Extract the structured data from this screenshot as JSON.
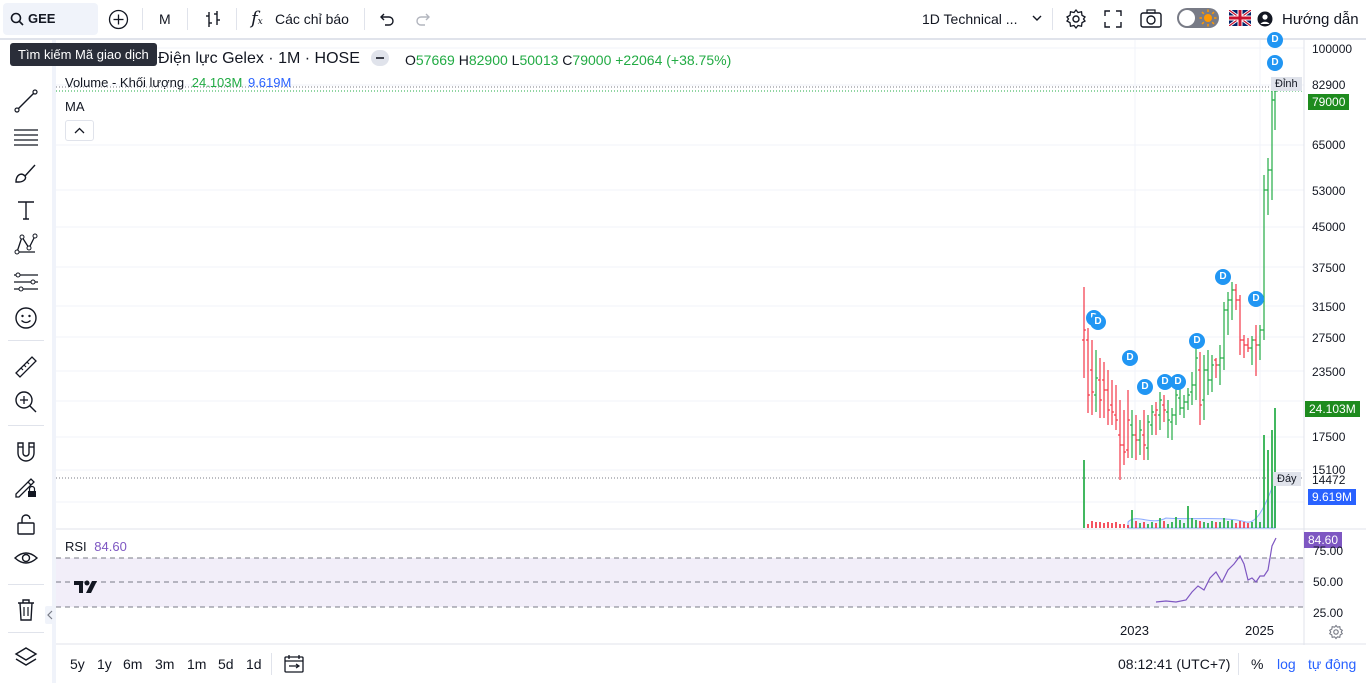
{
  "toolbar": {
    "symbol": "GEE",
    "interval": "M",
    "indicators_label": "Các chỉ báo",
    "layout_name": "1D Technical ...",
    "help_label": "Hướng dẫn"
  },
  "tooltip": {
    "text": "Tìm kiếm Mã giao dịch"
  },
  "legend": {
    "title": "Điện lực Gelex · 1M · HOSE",
    "o_label": "O",
    "o_value": "57669",
    "h_label": "H",
    "h_value": "82900",
    "l_label": "L",
    "l_value": "50013",
    "c_label": "C",
    "c_value": "79000",
    "change": "+22064 (+38.75%)",
    "volume_label": "Volume - Khối lượng",
    "volume_value": "24.103M",
    "volume_ma": "9.619M",
    "ma_label": "MA",
    "rsi_label": "RSI",
    "rsi_value": "84.60"
  },
  "price_axis": {
    "labels": [
      "100000",
      "82900",
      "65000",
      "53000",
      "45000",
      "37500",
      "31500",
      "27500",
      "23500",
      "17500",
      "15100",
      "14472"
    ],
    "high_tag_label": "Đỉnh",
    "high_value": "82900",
    "last_price": "79000",
    "volume_tag": "24.103M",
    "low_tag_label": "Đáy",
    "low_value": "14472",
    "volume_ma_tag": "9.619M",
    "rsi_tag": "84.60",
    "rsi_labels": [
      "75.00",
      "50.00",
      "25.00"
    ]
  },
  "time_axis": {
    "labels": [
      "2023",
      "2025"
    ]
  },
  "bottom_bar": {
    "ranges": [
      "5y",
      "1y",
      "6m",
      "3m",
      "1m",
      "5d",
      "1d"
    ],
    "clock": "08:12:41 (UTC+7)",
    "percent": "%",
    "log": "log",
    "auto": "tự động"
  },
  "dividend_marker": "D",
  "colors": {
    "up": "#089981",
    "up_bar": "#22ab44",
    "down": "#f23645",
    "rsi": "#7e57c2",
    "accent": "#2962ff",
    "last_price_bg": "#1e8b1e"
  },
  "chart_data": {
    "type": "bar",
    "description_axis": "monthly OHLC",
    "ohlc_last": {
      "open": 57669,
      "high": 82900,
      "low": 50013,
      "close": 79000
    },
    "price_range": [
      14472,
      82900
    ],
    "rsi_last": 84.6,
    "volume_last": "24.103M",
    "volume_ma_last": "9.619M"
  }
}
